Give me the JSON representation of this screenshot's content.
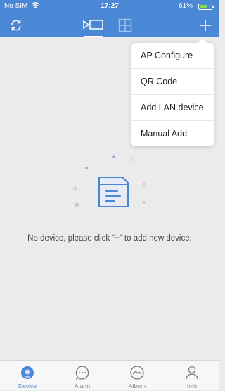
{
  "status_bar": {
    "carrier": "No SIM",
    "time": "17:27",
    "battery": "61%",
    "battery_level": 0.61
  },
  "app_bar": {
    "icons": [
      "refresh-icon",
      "single-view-icon",
      "grid-view-icon",
      "add-icon"
    ]
  },
  "dropdown_menu": {
    "items": [
      {
        "label": "AP Configure"
      },
      {
        "label": "QR Code"
      },
      {
        "label": "Add LAN device"
      },
      {
        "label": "Manual Add"
      }
    ]
  },
  "empty_state": {
    "message": "No device, please click “+” to add new device."
  },
  "tab_bar": {
    "tabs": [
      {
        "label": "Device",
        "icon": "device-icon",
        "active": true
      },
      {
        "label": "Alarm",
        "icon": "alarm-icon",
        "active": false
      },
      {
        "label": "Album",
        "icon": "album-icon",
        "active": false
      },
      {
        "label": "Info",
        "icon": "info-icon",
        "active": false
      }
    ]
  },
  "colors": {
    "accent": "#4a88d6",
    "background": "#ebebeb",
    "battery_fill": "#7ddc5a"
  }
}
